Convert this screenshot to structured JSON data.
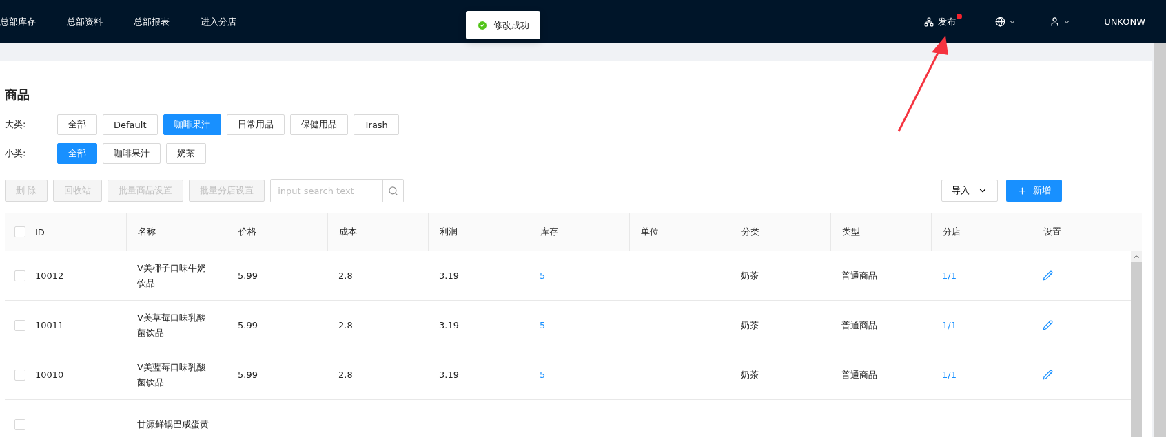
{
  "top_nav": {
    "links": [
      "总部库存",
      "总部资料",
      "总部报表",
      "进入分店"
    ],
    "publish": {
      "label": "发布",
      "badge": true
    },
    "user_name": "UNKONW"
  },
  "toast": {
    "message": "修改成功"
  },
  "page_title": "商品",
  "filters": [
    {
      "label": "大类:",
      "options": [
        {
          "label": "全部",
          "selected": false
        },
        {
          "label": "Default",
          "selected": false
        },
        {
          "label": "咖啡果汁",
          "selected": true
        },
        {
          "label": "日常用品",
          "selected": false
        },
        {
          "label": "保健用品",
          "selected": false
        },
        {
          "label": "Trash",
          "selected": false
        }
      ]
    },
    {
      "label": "小类:",
      "options": [
        {
          "label": "全部",
          "selected": true
        },
        {
          "label": "咖啡果汁",
          "selected": false
        },
        {
          "label": "奶茶",
          "selected": false
        }
      ]
    }
  ],
  "toolbar": {
    "buttons": [
      {
        "label": "删 除",
        "disabled": true
      },
      {
        "label": "回收站",
        "disabled": true
      },
      {
        "label": "批量商品设置",
        "disabled": true
      },
      {
        "label": "批量分店设置",
        "disabled": true
      }
    ],
    "search": {
      "placeholder": "input search text"
    },
    "import_button": "导入",
    "add_button": "新增"
  },
  "table": {
    "columns": [
      "ID",
      "名称",
      "价格",
      "成本",
      "利润",
      "库存",
      "单位",
      "分类",
      "类型",
      "分店",
      "设置"
    ],
    "header_checked": false,
    "rows": [
      {
        "checked": false,
        "id": "10012",
        "name": "V美椰子口味牛奶饮品",
        "price": "5.99",
        "cost": "2.8",
        "profit": "3.19",
        "stock": "5",
        "category": "奶茶",
        "type": "普通商品",
        "branches": "1/1"
      },
      {
        "checked": false,
        "id": "10011",
        "name": "V美草莓口味乳酸菌饮品",
        "price": "5.99",
        "cost": "2.8",
        "profit": "3.19",
        "stock": "5",
        "category": "奶茶",
        "type": "普通商品",
        "branches": "1/1"
      },
      {
        "checked": false,
        "id": "10010",
        "name": "V美蓝莓口味乳酸菌饮品",
        "price": "5.99",
        "cost": "2.8",
        "profit": "3.19",
        "stock": "5",
        "category": "奶茶",
        "type": "普通商品",
        "branches": "1/1"
      },
      {
        "checked": false,
        "name": "甘源鲜锅巴咸蛋黄"
      }
    ]
  }
}
